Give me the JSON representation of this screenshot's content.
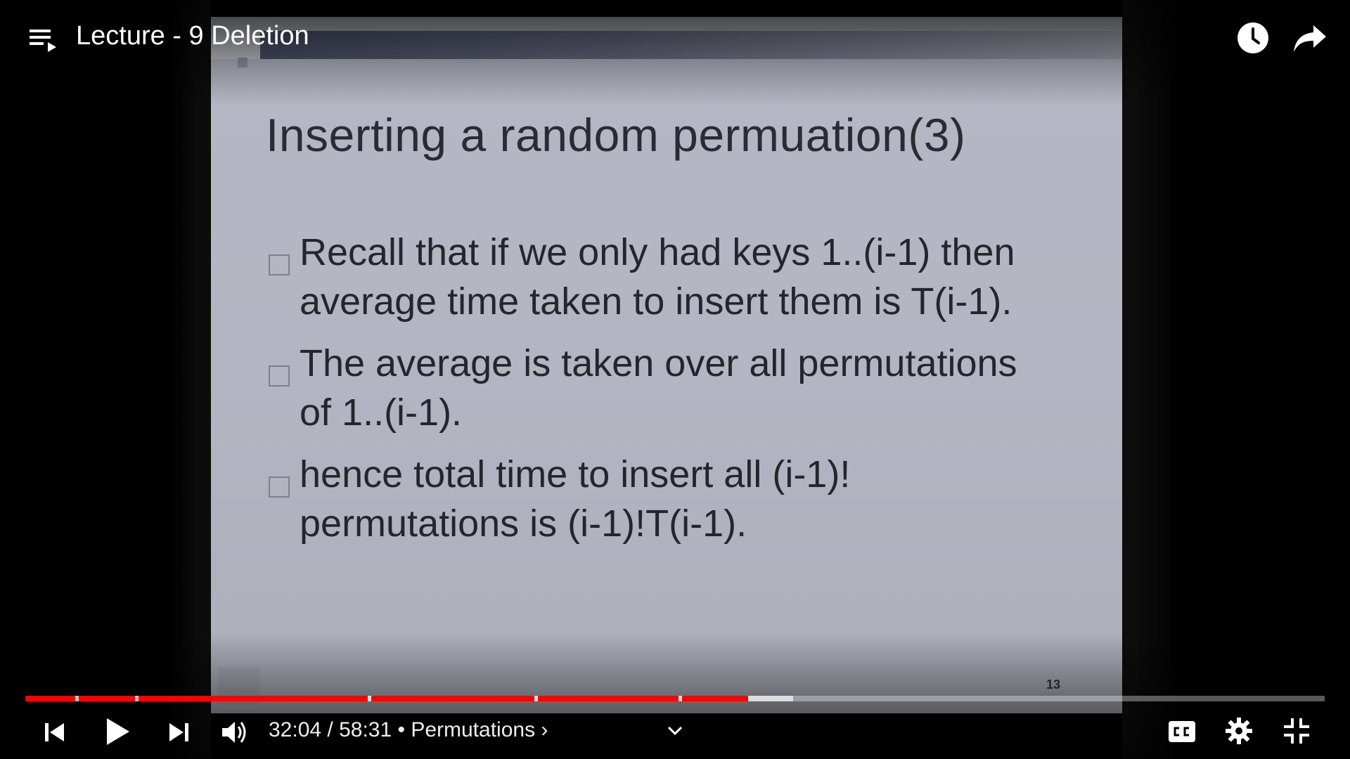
{
  "header": {
    "title": "Lecture - 9 Deletion",
    "icons": {
      "playlist": "playlist-icon",
      "watch_later": "clock-icon",
      "share": "share-icon"
    }
  },
  "slide": {
    "title": "Inserting a random permuation(3)",
    "bullets": [
      [
        "Recall that if we only had keys 1..(i-1) then",
        "average time taken to insert them is T(i-1)."
      ],
      [
        "The average is taken over all permutations",
        "of 1..(i-1)."
      ],
      [
        "hence total time to insert all (i-1)!",
        "permutations is (i-1)!T(i-1)."
      ]
    ],
    "page_number": "13"
  },
  "player": {
    "time_display": "32:04 / 58:31 • Permutations ›",
    "progress_fraction": 0.548,
    "buffered_fraction": 0.591,
    "colors": {
      "played": "#ff0000",
      "track": "#ffffff59"
    },
    "buttons": {
      "previous": "previous-icon",
      "play": "play-icon",
      "next": "next-icon",
      "volume": "volume-icon",
      "chapter_expand": "chevron-down-icon",
      "captions": "cc-icon",
      "settings": "gear-icon",
      "exit_fullscreen": "exit-fullscreen-icon"
    }
  }
}
